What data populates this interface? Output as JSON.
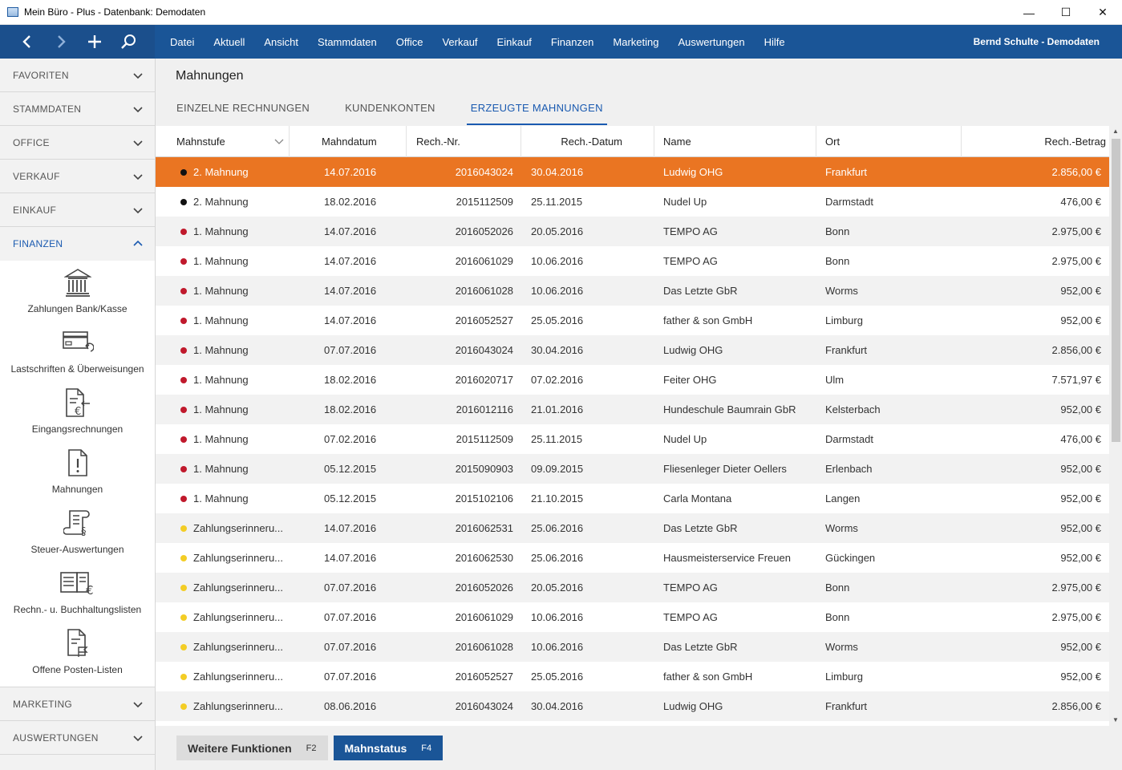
{
  "window": {
    "title": "Mein Büro - Plus - Datenbank: Demodaten",
    "controls": [
      "—",
      "☐",
      "✕"
    ]
  },
  "nav": {
    "buttons": [
      "back-icon",
      "forward-icon",
      "plus-icon",
      "search-icon"
    ],
    "menu": [
      "Datei",
      "Aktuell",
      "Ansicht",
      "Stammdaten",
      "Office",
      "Verkauf",
      "Einkauf",
      "Finanzen",
      "Marketing",
      "Auswertungen",
      "Hilfe"
    ],
    "user": "Bernd Schulte - Demodaten",
    "color": "#1a5597"
  },
  "sidebar": {
    "sections_top": [
      "FAVORITEN",
      "STAMMDATEN",
      "OFFICE",
      "VERKAUF",
      "EINKAUF"
    ],
    "active_section": "FINANZEN",
    "finanzen_items": [
      {
        "label": "Zahlungen Bank/Kasse",
        "icon": "bank-icon"
      },
      {
        "label": "Lastschriften & Überweisungen",
        "icon": "card-transfer-icon"
      },
      {
        "label": "Eingangsrechnungen",
        "icon": "incoming-invoice-icon"
      },
      {
        "label": "Mahnungen",
        "icon": "reminder-document-icon"
      },
      {
        "label": "Steuer-Auswertungen",
        "icon": "tax-document-icon"
      },
      {
        "label": "Rechn.- u. Buchhaltungslisten",
        "icon": "invoice-list-icon"
      },
      {
        "label": "Offene Posten-Listen",
        "icon": "open-items-icon"
      }
    ],
    "sections_bottom": [
      "MARKETING",
      "AUSWERTUNGEN"
    ]
  },
  "main": {
    "title": "Mahnungen",
    "tabs": [
      "EINZELNE RECHNUNGEN",
      "KUNDENKONTEN",
      "ERZEUGTE MAHNUNGEN"
    ],
    "active_tab": 2,
    "columns": [
      "Mahnstufe",
      "Mahndatum",
      "Rech.-Nr.",
      "Rech.-Datum",
      "Name",
      "Ort",
      "Rech.-Betrag"
    ],
    "rows": [
      {
        "level": "2. Mahnung",
        "dot": "#111111",
        "date": "14.07.2016",
        "nr": "2016043024",
        "rdate": "30.04.2016",
        "name": "Ludwig OHG",
        "city": "Frankfurt",
        "amount": "2.856,00 €"
      },
      {
        "level": "2. Mahnung",
        "dot": "#111111",
        "date": "18.02.2016",
        "nr": "2015112509",
        "rdate": "25.11.2015",
        "name": "Nudel Up",
        "city": "Darmstadt",
        "amount": "476,00 €"
      },
      {
        "level": "1. Mahnung",
        "dot": "#c0192c",
        "date": "14.07.2016",
        "nr": "2016052026",
        "rdate": "20.05.2016",
        "name": "TEMPO AG",
        "city": "Bonn",
        "amount": "2.975,00 €"
      },
      {
        "level": "1. Mahnung",
        "dot": "#c0192c",
        "date": "14.07.2016",
        "nr": "2016061029",
        "rdate": "10.06.2016",
        "name": "TEMPO AG",
        "city": "Bonn",
        "amount": "2.975,00 €"
      },
      {
        "level": "1. Mahnung",
        "dot": "#c0192c",
        "date": "14.07.2016",
        "nr": "2016061028",
        "rdate": "10.06.2016",
        "name": "Das Letzte GbR",
        "city": "Worms",
        "amount": "952,00 €"
      },
      {
        "level": "1. Mahnung",
        "dot": "#c0192c",
        "date": "14.07.2016",
        "nr": "2016052527",
        "rdate": "25.05.2016",
        "name": "father & son GmbH",
        "city": "Limburg",
        "amount": "952,00 €"
      },
      {
        "level": "1. Mahnung",
        "dot": "#c0192c",
        "date": "07.07.2016",
        "nr": "2016043024",
        "rdate": "30.04.2016",
        "name": "Ludwig OHG",
        "city": "Frankfurt",
        "amount": "2.856,00 €"
      },
      {
        "level": "1. Mahnung",
        "dot": "#c0192c",
        "date": "18.02.2016",
        "nr": "2016020717",
        "rdate": "07.02.2016",
        "name": "Feiter OHG",
        "city": "Ulm",
        "amount": "7.571,97 €"
      },
      {
        "level": "1. Mahnung",
        "dot": "#c0192c",
        "date": "18.02.2016",
        "nr": "2016012116",
        "rdate": "21.01.2016",
        "name": "Hundeschule Baumrain GbR",
        "city": "Kelsterbach",
        "amount": "952,00 €"
      },
      {
        "level": "1. Mahnung",
        "dot": "#c0192c",
        "date": "07.02.2016",
        "nr": "2015112509",
        "rdate": "25.11.2015",
        "name": "Nudel Up",
        "city": "Darmstadt",
        "amount": "476,00 €"
      },
      {
        "level": "1. Mahnung",
        "dot": "#c0192c",
        "date": "05.12.2015",
        "nr": "2015090903",
        "rdate": "09.09.2015",
        "name": "Fliesenleger Dieter Oellers",
        "city": "Erlenbach",
        "amount": "952,00 €"
      },
      {
        "level": "1. Mahnung",
        "dot": "#c0192c",
        "date": "05.12.2015",
        "nr": "2015102106",
        "rdate": "21.10.2015",
        "name": "Carla Montana",
        "city": "Langen",
        "amount": "952,00 €"
      },
      {
        "level": "Zahlungserinneru...",
        "dot": "#f3cd25",
        "date": "14.07.2016",
        "nr": "2016062531",
        "rdate": "25.06.2016",
        "name": "Das Letzte GbR",
        "city": "Worms",
        "amount": "952,00 €"
      },
      {
        "level": "Zahlungserinneru...",
        "dot": "#f3cd25",
        "date": "14.07.2016",
        "nr": "2016062530",
        "rdate": "25.06.2016",
        "name": "Hausmeisterservice Freuen",
        "city": "Gückingen",
        "amount": "952,00 €"
      },
      {
        "level": "Zahlungserinneru...",
        "dot": "#f3cd25",
        "date": "07.07.2016",
        "nr": "2016052026",
        "rdate": "20.05.2016",
        "name": "TEMPO AG",
        "city": "Bonn",
        "amount": "2.975,00 €"
      },
      {
        "level": "Zahlungserinneru...",
        "dot": "#f3cd25",
        "date": "07.07.2016",
        "nr": "2016061029",
        "rdate": "10.06.2016",
        "name": "TEMPO AG",
        "city": "Bonn",
        "amount": "2.975,00 €"
      },
      {
        "level": "Zahlungserinneru...",
        "dot": "#f3cd25",
        "date": "07.07.2016",
        "nr": "2016061028",
        "rdate": "10.06.2016",
        "name": "Das Letzte GbR",
        "city": "Worms",
        "amount": "952,00 €"
      },
      {
        "level": "Zahlungserinneru...",
        "dot": "#f3cd25",
        "date": "07.07.2016",
        "nr": "2016052527",
        "rdate": "25.05.2016",
        "name": "father & son GmbH",
        "city": "Limburg",
        "amount": "952,00 €"
      },
      {
        "level": "Zahlungserinneru...",
        "dot": "#f3cd25",
        "date": "08.06.2016",
        "nr": "2016043024",
        "rdate": "30.04.2016",
        "name": "Ludwig OHG",
        "city": "Frankfurt",
        "amount": "2.856,00 €"
      }
    ],
    "selected_row": 0,
    "selected_color": "#ea7522"
  },
  "footer": {
    "buttons": [
      {
        "label": "Weitere Funktionen",
        "key": "F2"
      },
      {
        "label": "Mahnstatus",
        "key": "F4"
      }
    ]
  }
}
